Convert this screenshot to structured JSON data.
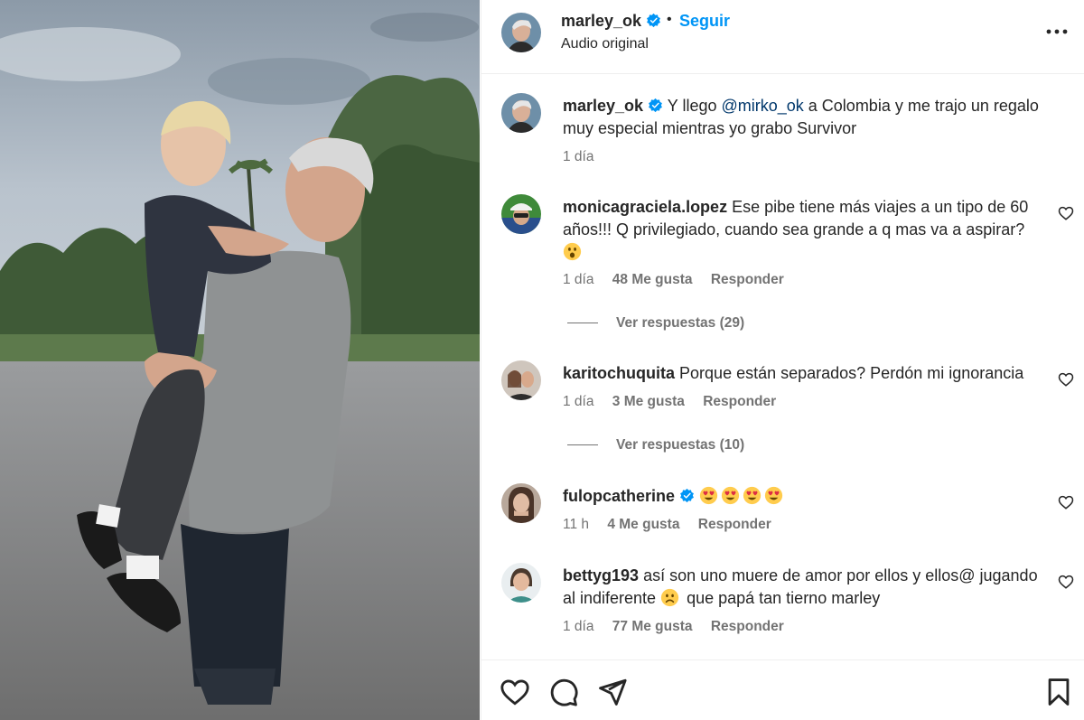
{
  "header": {
    "username": "marley_ok",
    "separator": "•",
    "follow_label": "Seguir",
    "audio_label": "Audio original"
  },
  "caption": {
    "username": "marley_ok",
    "text_before": "Y llego ",
    "mention": "@mirko_ok",
    "text_after": " a Colombia y me trajo un regalo muy especial mientras yo grabo Survivor",
    "time": "1 día"
  },
  "comments": [
    {
      "username": "monicagraciela.lopez",
      "text": "Ese pibe tiene más viajes a un tipo de 60 años!!! Q privilegiado, cuando sea grande a q mas va a aspirar?",
      "emoji": "astonished-face",
      "time": "1 día",
      "likes": "48 Me gusta",
      "reply_label": "Responder",
      "view_replies": "Ver respuestas (29)"
    },
    {
      "username": "karitochuquita",
      "text": "Porque están separados? Perdón mi ignorancia",
      "time": "1 día",
      "likes": "3 Me gusta",
      "reply_label": "Responder",
      "view_replies": "Ver respuestas (10)"
    },
    {
      "username": "fulopcatherine",
      "verified": true,
      "emoji": "heart-eyes-face x4",
      "time": "11 h",
      "likes": "4 Me gusta",
      "reply_label": "Responder"
    },
    {
      "username": "bettyg193",
      "text_before": "así son uno muere de amor por ellos y ellos@ jugando al indiferente ",
      "emoji": "frowning-face",
      "text_after": " que papá tan tierno marley",
      "time": "1 día",
      "likes": "77 Me gusta",
      "reply_label": "Responder"
    }
  ],
  "actions": [
    "like-icon",
    "comment-icon",
    "share-icon",
    "save-icon"
  ],
  "colors": {
    "link_blue": "#0095f6",
    "mention_blue": "#00376b",
    "verified_blue": "#0095f6",
    "secondary_text": "#737373",
    "primary_text": "#262626"
  }
}
